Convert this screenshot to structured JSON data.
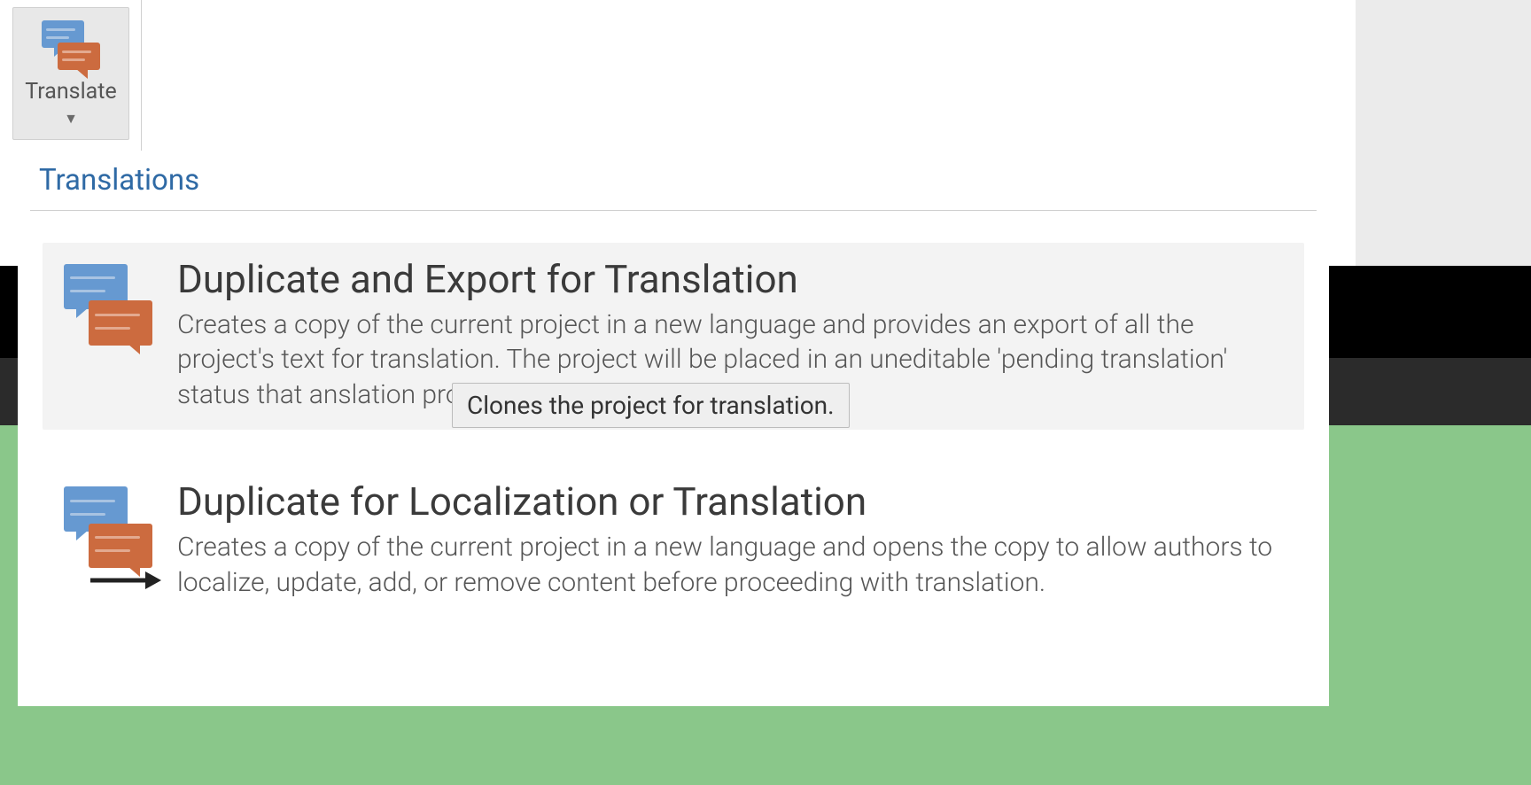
{
  "toolbar": {
    "translate_label": "Translate"
  },
  "dropdown": {
    "header": "Translations",
    "items": [
      {
        "title": "Duplicate and Export for Translation",
        "description": "Creates a copy of the current project in a new language and provides an export of all the project's text for translation. The project will be placed in an uneditable 'pending translation' status that                                                                anslation process."
      },
      {
        "title": "Duplicate for Localization or Translation",
        "description": "Creates a copy of the current project in a new language and opens the copy to allow authors to localize, update, add, or remove content before proceeding with translation."
      }
    ]
  },
  "tooltip": {
    "text": "Clones the project for translation."
  }
}
